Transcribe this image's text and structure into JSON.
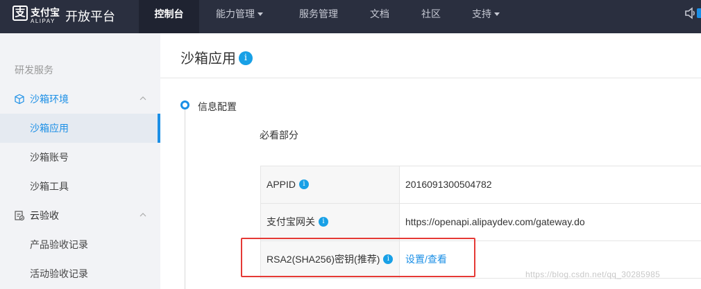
{
  "brand": {
    "logo_cn": "支付宝",
    "logo_en": "ALIPAY",
    "platform": "开放平台"
  },
  "nav": {
    "items": [
      {
        "label": "控制台",
        "active": true,
        "dropdown": false
      },
      {
        "label": "能力管理",
        "active": false,
        "dropdown": true
      },
      {
        "label": "服务管理",
        "active": false,
        "dropdown": false
      },
      {
        "label": "文档",
        "active": false,
        "dropdown": false
      },
      {
        "label": "社区",
        "active": false,
        "dropdown": false
      },
      {
        "label": "支持",
        "active": false,
        "dropdown": true
      }
    ],
    "icons": [
      "speaker-icon"
    ]
  },
  "sidebar": {
    "section_title": "研发服务",
    "groups": [
      {
        "label": "沙箱环境",
        "icon": "cube-icon",
        "expanded": true,
        "items": [
          {
            "label": "沙箱应用",
            "active": true
          },
          {
            "label": "沙箱账号",
            "active": false
          },
          {
            "label": "沙箱工具",
            "active": false
          }
        ]
      },
      {
        "label": "云验收",
        "icon": "checklist-icon",
        "expanded": true,
        "items": [
          {
            "label": "产品验收记录",
            "active": false
          },
          {
            "label": "活动验收记录",
            "active": false
          }
        ]
      }
    ]
  },
  "main": {
    "title": "沙箱应用",
    "info_glyph": "i",
    "step_label": "信息配置",
    "subhead": "必看部分",
    "rows": [
      {
        "key": "APPID",
        "value": "2016091300504782",
        "is_link": false
      },
      {
        "key": "支付宝网关",
        "value": "https://openapi.alipaydev.com/gateway.do",
        "is_link": false
      },
      {
        "key": "RSA2(SHA256)密钥(推荐)",
        "value": "设置/查看",
        "is_link": true
      }
    ]
  },
  "watermark": "https://blog.csdn.net/qq_30285985",
  "colors": {
    "topbar": "#2a2f3f",
    "accent": "#1b8fe6",
    "highlight": "#e53935",
    "sidebar_bg": "#f2f3f6"
  }
}
